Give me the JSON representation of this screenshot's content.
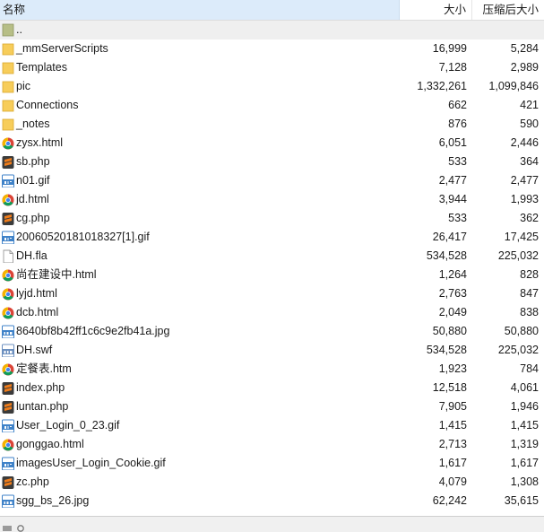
{
  "columns": {
    "name": "名称",
    "size": "大小",
    "compressed": "压缩后大小"
  },
  "colors": {
    "folder": "#f7cd5a",
    "parent_icon": "#b7be86",
    "php_icon": "#ef7c1a",
    "gif_jpg_icon": "#3f82c8",
    "header_selected": "#dcebfa"
  },
  "files": [
    {
      "name": "..",
      "size": "",
      "compressed": "",
      "icon": "parent-folder-icon"
    },
    {
      "name": "_mmServerScripts",
      "size": "16,999",
      "compressed": "5,284",
      "icon": "folder-icon"
    },
    {
      "name": "Templates",
      "size": "7,128",
      "compressed": "2,989",
      "icon": "folder-icon"
    },
    {
      "name": "pic",
      "size": "1,332,261",
      "compressed": "1,099,846",
      "icon": "folder-icon"
    },
    {
      "name": "Connections",
      "size": "662",
      "compressed": "421",
      "icon": "folder-icon"
    },
    {
      "name": "_notes",
      "size": "876",
      "compressed": "590",
      "icon": "folder-icon"
    },
    {
      "name": "zysx.html",
      "size": "6,051",
      "compressed": "2,446",
      "icon": "chrome-icon"
    },
    {
      "name": "sb.php",
      "size": "533",
      "compressed": "364",
      "icon": "sublime-icon"
    },
    {
      "name": "n01.gif",
      "size": "2,477",
      "compressed": "2,477",
      "icon": "gif-icon"
    },
    {
      "name": "jd.html",
      "size": "3,944",
      "compressed": "1,993",
      "icon": "chrome-icon"
    },
    {
      "name": "cg.php",
      "size": "533",
      "compressed": "362",
      "icon": "sublime-icon"
    },
    {
      "name": "20060520181018327[1].gif",
      "size": "26,417",
      "compressed": "17,425",
      "icon": "gif-icon"
    },
    {
      "name": "DH.fla",
      "size": "534,528",
      "compressed": "225,032",
      "icon": "blank-file-icon"
    },
    {
      "name": "尚在建设中.html",
      "size": "1,264",
      "compressed": "828",
      "icon": "chrome-icon"
    },
    {
      "name": "lyjd.html",
      "size": "2,763",
      "compressed": "847",
      "icon": "chrome-icon"
    },
    {
      "name": "dcb.html",
      "size": "2,049",
      "compressed": "838",
      "icon": "chrome-icon"
    },
    {
      "name": "8640bf8b42ff1c6c9e2fb41a.jpg",
      "size": "50,880",
      "compressed": "50,880",
      "icon": "jpg-icon"
    },
    {
      "name": "DH.swf",
      "size": "534,528",
      "compressed": "225,032",
      "icon": "swf-icon"
    },
    {
      "name": "定餐表.htm",
      "size": "1,923",
      "compressed": "784",
      "icon": "chrome-icon"
    },
    {
      "name": "index.php",
      "size": "12,518",
      "compressed": "4,061",
      "icon": "sublime-icon"
    },
    {
      "name": "luntan.php",
      "size": "7,905",
      "compressed": "1,946",
      "icon": "sublime-icon"
    },
    {
      "name": "User_Login_0_23.gif",
      "size": "1,415",
      "compressed": "1,415",
      "icon": "gif-icon"
    },
    {
      "name": "gonggao.html",
      "size": "2,713",
      "compressed": "1,319",
      "icon": "chrome-icon"
    },
    {
      "name": "imagesUser_Login_Cookie.gif",
      "size": "1,617",
      "compressed": "1,617",
      "icon": "gif-icon"
    },
    {
      "name": "zc.php",
      "size": "4,079",
      "compressed": "1,308",
      "icon": "sublime-icon"
    },
    {
      "name": "sgg_bs_26.jpg",
      "size": "62,242",
      "compressed": "35,615",
      "icon": "jpg-icon"
    },
    {
      "name": "",
      "size": "",
      "compressed": "",
      "icon": ""
    }
  ]
}
